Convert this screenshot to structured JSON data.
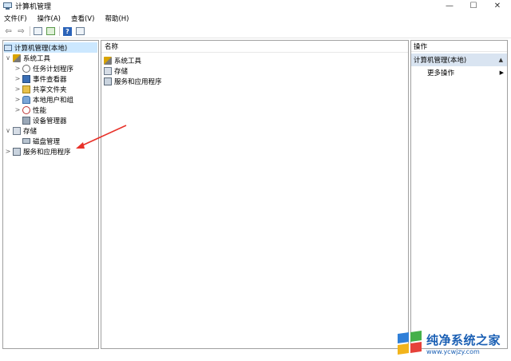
{
  "window": {
    "title": "计算机管理",
    "controls": {
      "minimize": "—",
      "maximize": "☐",
      "close": "✕"
    }
  },
  "menu": [
    "文件(F)",
    "操作(A)",
    "查看(V)",
    "帮助(H)"
  ],
  "toolbar": {
    "icons": [
      "back-arrow-icon",
      "forward-arrow-icon",
      "console-tree-icon",
      "export-list-icon",
      "help-icon",
      "properties-icon"
    ],
    "back": "⇦",
    "forward": "⇨",
    "help": "?"
  },
  "tree": [
    {
      "label": "计算机管理(本地)",
      "level": 0,
      "expander": "",
      "icon": "computer-icon",
      "selected": true
    },
    {
      "label": "系统工具",
      "level": 1,
      "expander": "∨",
      "icon": "tools-icon"
    },
    {
      "label": "任务计划程序",
      "level": 2,
      "expander": ">",
      "icon": "clock-icon"
    },
    {
      "label": "事件查看器",
      "level": 2,
      "expander": ">",
      "icon": "event-viewer-icon"
    },
    {
      "label": "共享文件夹",
      "level": 2,
      "expander": ">",
      "icon": "shared-folder-icon"
    },
    {
      "label": "本地用户和组",
      "level": 2,
      "expander": ">",
      "icon": "users-icon"
    },
    {
      "label": "性能",
      "level": 2,
      "expander": ">",
      "icon": "performance-icon"
    },
    {
      "label": "设备管理器",
      "level": 2,
      "expander": "",
      "icon": "device-manager-icon"
    },
    {
      "label": "存储",
      "level": 1,
      "expander": "∨",
      "icon": "storage-icon"
    },
    {
      "label": "磁盘管理",
      "level": 2,
      "expander": "",
      "icon": "disk-icon"
    },
    {
      "label": "服务和应用程序",
      "level": 1,
      "expander": ">",
      "icon": "services-icon"
    }
  ],
  "main": {
    "column_header": "名称",
    "items": [
      {
        "label": "系统工具",
        "icon": "tools-icon"
      },
      {
        "label": "存储",
        "icon": "storage-icon"
      },
      {
        "label": "服务和应用程序",
        "icon": "services-icon"
      }
    ]
  },
  "actions": {
    "header": "操作",
    "section": "计算机管理(本地)",
    "section_caret": "▲",
    "items": [
      {
        "label": "更多操作",
        "arrow": "▶"
      }
    ]
  },
  "annotation": {
    "color": "#e8322a"
  },
  "watermark": {
    "title": "纯净系统之家",
    "url": "www.ycwjzy.com"
  }
}
